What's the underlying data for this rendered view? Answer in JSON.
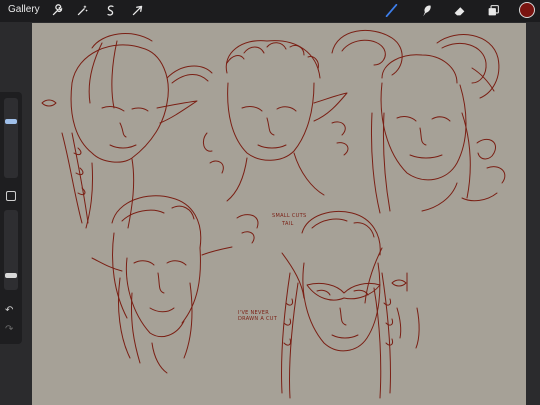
{
  "topbar": {
    "gallery_label": "Gallery",
    "left_tools": [
      "wrench-icon",
      "magic-wand-icon",
      "selection-icon",
      "transform-arrow-icon"
    ],
    "right_tools": [
      "brush-icon",
      "smudge-icon",
      "eraser-icon",
      "layers-icon"
    ],
    "active_tool": "brush-icon",
    "active_color": "#7a1410"
  },
  "sidebar": {
    "brush_size_level": 0.72,
    "opacity_level": 0.15
  },
  "canvas": {
    "background": "#a6a197",
    "ink": "#7a1f14",
    "annotations": {
      "note_small": "Small cuts",
      "note_tail": "Tail",
      "note_never": "I've never drawn a cut"
    }
  },
  "colors": {
    "toolbar_bg": "#1c1c1e",
    "accent_blue": "#3d7eea"
  }
}
